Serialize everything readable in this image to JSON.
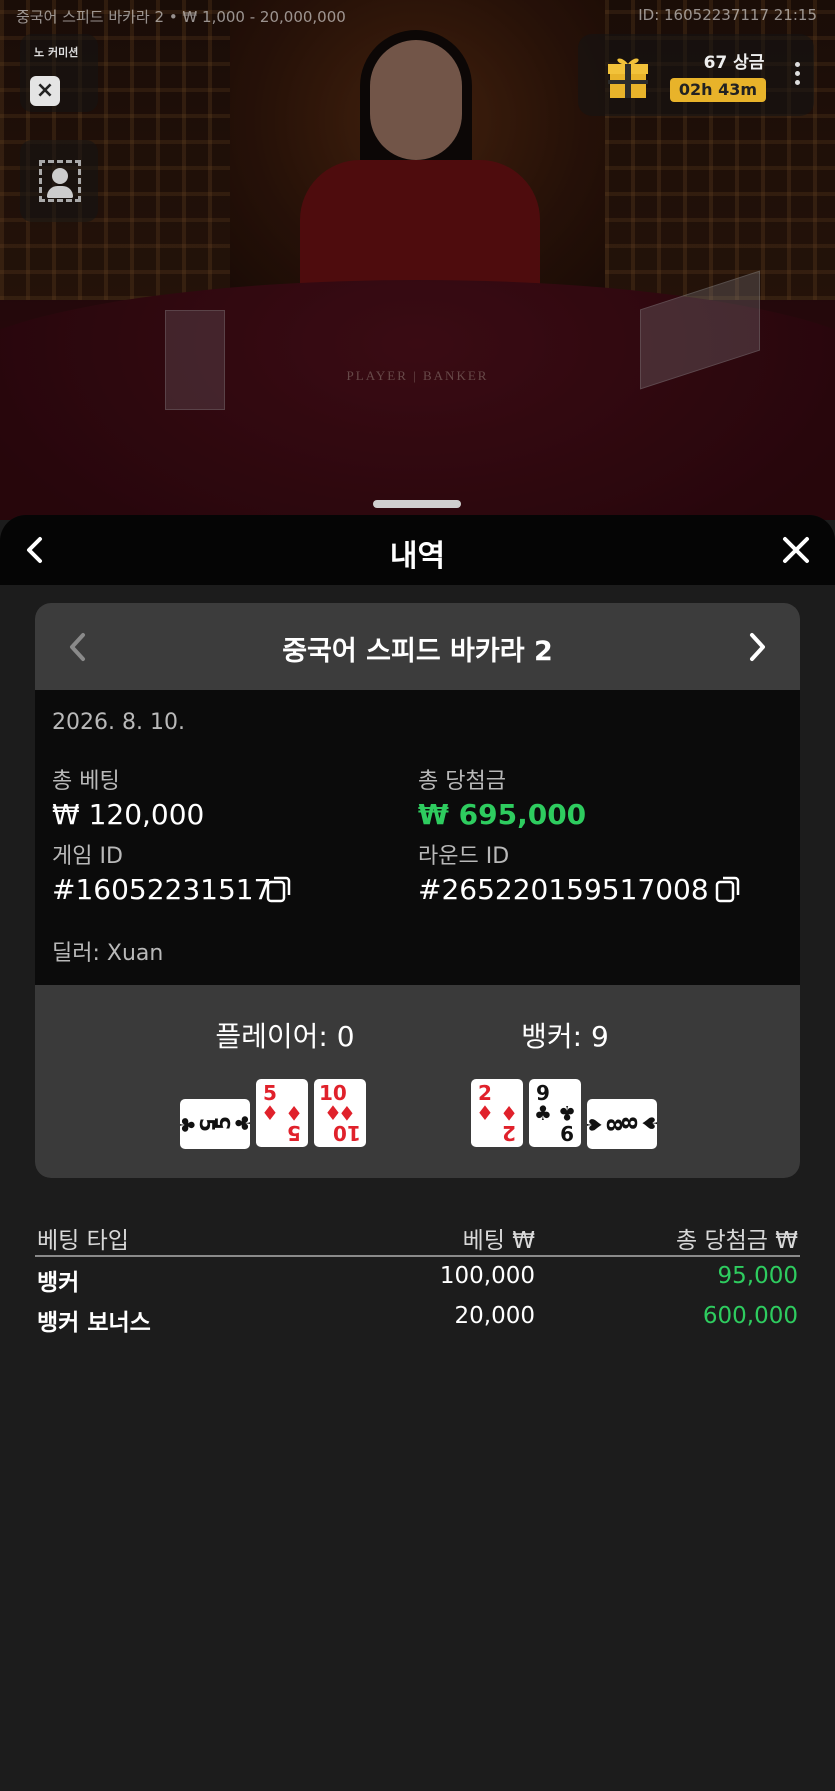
{
  "stage": {
    "top_left_info": "중국어 스피드 바카라 2 • ₩ 1,000 - 20,000,000",
    "top_right_info": "ID: 16052237117 21:15",
    "table_label": "PLAYER | BANKER",
    "no_commission_label": "노 커미션",
    "prize_count": "67 상금",
    "prize_timer": "02h 43m"
  },
  "panel": {
    "title": "내역",
    "game_name": "중국어 스피드 바카라 2",
    "date": "2026. 8. 10.",
    "total_bet_label": "총 베팅",
    "total_bet_value": "₩ 120,000",
    "total_win_label": "총 당첨금",
    "total_win_value": "₩ 695,000",
    "game_id_label": "게임 ID",
    "game_id_value": "#16052231517",
    "round_id_label": "라운드 ID",
    "round_id_value": "#265220159517008",
    "dealer": "딜러: Xuan",
    "player_title": "플레이어: 0",
    "banker_title": "뱅커: 9",
    "player_cards": [
      {
        "rank": "5",
        "suit": "♣",
        "color": "black",
        "orientation": "horizontal"
      },
      {
        "rank": "5",
        "suit": "♦",
        "color": "red",
        "orientation": "vertical"
      },
      {
        "rank": "10",
        "suit": "♦",
        "color": "red",
        "orientation": "vertical"
      }
    ],
    "banker_cards": [
      {
        "rank": "2",
        "suit": "♦",
        "color": "red",
        "orientation": "vertical"
      },
      {
        "rank": "9",
        "suit": "♣",
        "color": "black",
        "orientation": "vertical"
      },
      {
        "rank": "8",
        "suit": "♠",
        "color": "black",
        "orientation": "horizontal"
      }
    ],
    "bets_table": {
      "headers": [
        "베팅 타입",
        "베팅 ₩",
        "총 당첨금 ₩"
      ],
      "rows": [
        {
          "type": "뱅커",
          "bet": "100,000",
          "win": "95,000"
        },
        {
          "type": "뱅커 보너스",
          "bet": "20,000",
          "win": "600,000"
        }
      ]
    }
  },
  "colors": {
    "win_green": "#2ecc5f",
    "timer_gold": "#e8b32a",
    "card_red": "#e0212b"
  },
  "icons": {
    "back": "chevron-left-icon",
    "close": "close-icon",
    "copy": "copy-icon",
    "gift": "gift-icon",
    "more": "more-vertical-icon"
  }
}
